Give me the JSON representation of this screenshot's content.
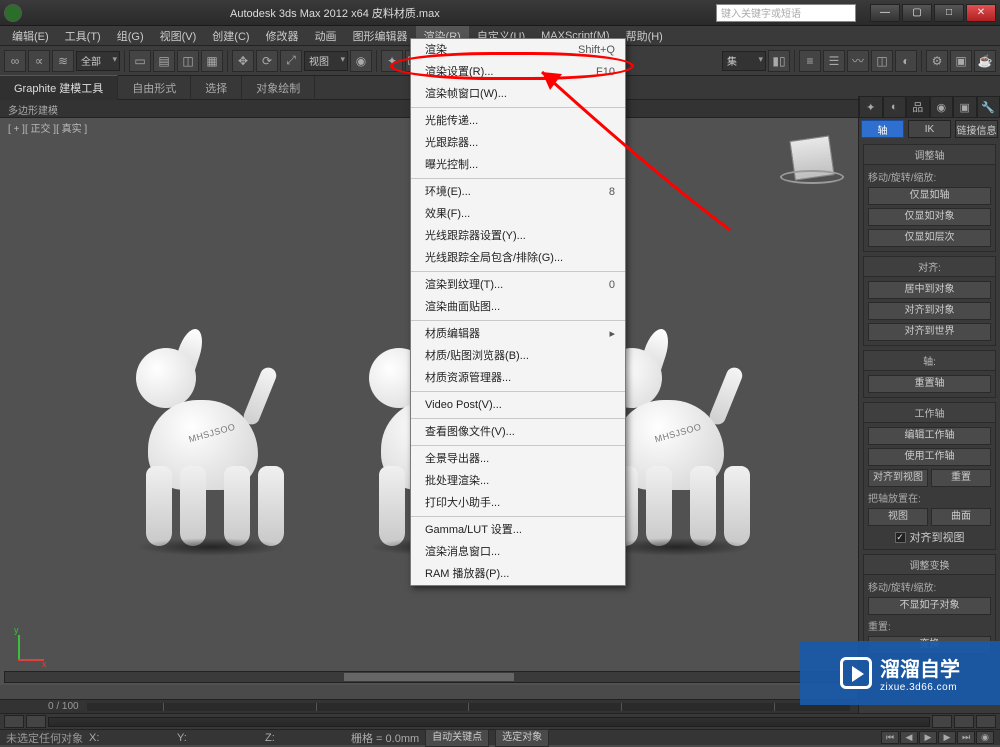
{
  "app": {
    "title": "Autodesk 3ds Max 2012 x64   皮料材质.max",
    "search_placeholder": "键入关键字或短语"
  },
  "menubar": [
    "编辑(E)",
    "工具(T)",
    "组(G)",
    "视图(V)",
    "创建(C)",
    "修改器",
    "动画",
    "图形编辑器",
    "渲染(R)",
    "自定义(U)",
    "MAXScript(M)",
    "帮助(H)"
  ],
  "toolbar": {
    "selection_filter": "全部",
    "view_label": "视图",
    "ref_dd": "集"
  },
  "ribbon": {
    "tabs": [
      "Graphite 建模工具",
      "自由形式",
      "选择",
      "对象绘制"
    ],
    "sub": "多边形建模"
  },
  "viewport": {
    "label": "[ + ][ 正交 ][ 真实 ]",
    "watermark_text": "MHSJSOO",
    "axes": {
      "x": "x",
      "y": "y"
    }
  },
  "timeline": {
    "frame_label": "0 / 100"
  },
  "render_menu": {
    "items": [
      {
        "label": "渲染",
        "shortcut": "Shift+Q"
      },
      {
        "label": "渲染设置(R)...",
        "shortcut": "F10",
        "highlight": true
      },
      {
        "label": "渲染帧窗口(W)..."
      },
      {
        "sep": true
      },
      {
        "label": "光能传递..."
      },
      {
        "label": "光跟踪器..."
      },
      {
        "label": "曝光控制..."
      },
      {
        "sep": true
      },
      {
        "label": "环境(E)...",
        "shortcut": "8"
      },
      {
        "label": "效果(F)..."
      },
      {
        "label": "光线跟踪器设置(Y)..."
      },
      {
        "label": "光线跟踪全局包含/排除(G)..."
      },
      {
        "sep": true
      },
      {
        "label": "渲染到纹理(T)...",
        "shortcut": "0"
      },
      {
        "label": "渲染曲面贴图..."
      },
      {
        "sep": true
      },
      {
        "label": "材质编辑器",
        "shortcut": "▸"
      },
      {
        "label": "材质/贴图浏览器(B)..."
      },
      {
        "label": "材质资源管理器..."
      },
      {
        "sep": true
      },
      {
        "label": "Video Post(V)..."
      },
      {
        "sep": true
      },
      {
        "label": "查看图像文件(V)..."
      },
      {
        "sep": true
      },
      {
        "label": "全景导出器..."
      },
      {
        "label": "批处理渲染..."
      },
      {
        "label": "打印大小助手..."
      },
      {
        "sep": true
      },
      {
        "label": "Gamma/LUT 设置..."
      },
      {
        "label": "渲染消息窗口..."
      },
      {
        "label": "RAM 播放器(P)..."
      }
    ]
  },
  "cmd": {
    "sub": {
      "axis": "轴",
      "ik": "IK",
      "link": "链接信息"
    },
    "roll_adjust_axis": {
      "title": "调整轴",
      "label": "移动/旋转/缩放:",
      "b1": "仅显如轴",
      "b2": "仅显如对象",
      "b3": "仅显如层次"
    },
    "roll_align": {
      "title": "对齐:",
      "b1": "居中到对象",
      "b2": "对齐到对象",
      "b3": "对齐到世界"
    },
    "roll_axes": {
      "title": "轴:",
      "b1": "重置轴"
    },
    "roll_workaxis": {
      "title": "工作轴",
      "b1": "编辑工作轴",
      "b2": "使用工作轴",
      "b3a": "对齐到视图",
      "b3b": "重置",
      "label2": "把轴放置在:",
      "b4a": "视图",
      "b4b": "曲面",
      "chk": "对齐到视图"
    },
    "roll_transform": {
      "title": "调整变换",
      "label": "移动/旋转/缩放:",
      "b1": "不显如子对象",
      "label2": "重置:",
      "b2": "变换"
    }
  },
  "status": {
    "prompt": "未选定任何对象",
    "x": "",
    "y": "",
    "z": "",
    "grid": "栅格 = 0.0mm",
    "keymode": "自动关键点",
    "selset": "选定对象"
  },
  "watermark": {
    "brand": "溜溜自学",
    "url": "zixue.3d66.com"
  }
}
